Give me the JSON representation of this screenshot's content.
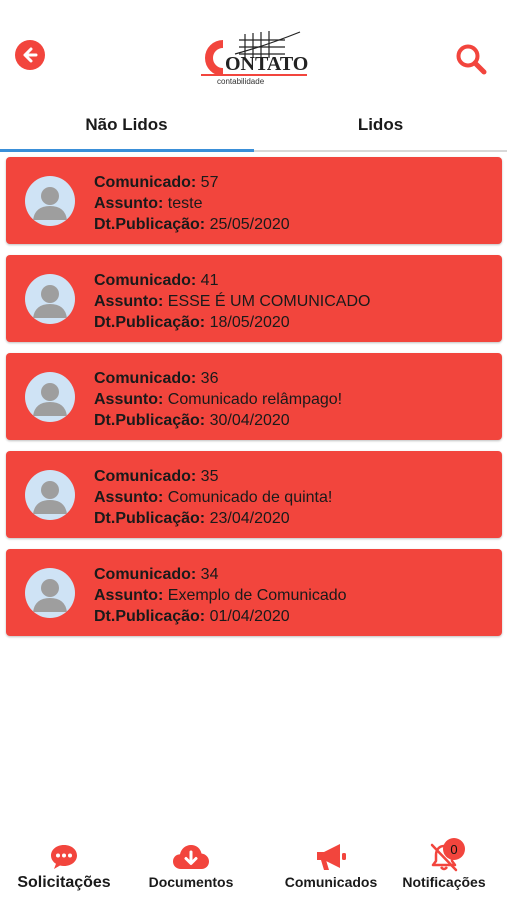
{
  "header": {
    "logo_text": "CONTATO",
    "logo_subtitle": "contabilidade"
  },
  "tabs": [
    {
      "label": "Não Lidos",
      "active": true
    },
    {
      "label": "Lidos",
      "active": false
    }
  ],
  "labels": {
    "comunicado": "Comunicado:",
    "assunto": "Assunto:",
    "publicacao": "Dt.Publicação:"
  },
  "items": [
    {
      "id": "57",
      "assunto": "teste",
      "data": "25/05/2020"
    },
    {
      "id": "41",
      "assunto": "ESSE É UM COMUNICADO",
      "data": "18/05/2020"
    },
    {
      "id": "36",
      "assunto": "Comunicado relâmpago!",
      "data": "30/04/2020"
    },
    {
      "id": "35",
      "assunto": "Comunicado de quinta!",
      "data": "23/04/2020"
    },
    {
      "id": "34",
      "assunto": "Exemplo de Comunicado",
      "data": "01/04/2020"
    }
  ],
  "bottom_nav": [
    {
      "label": "Solicitações",
      "icon": "chat-icon"
    },
    {
      "label": "Documentos",
      "icon": "cloud-download-icon"
    },
    {
      "label": "Comunicados",
      "icon": "megaphone-icon"
    },
    {
      "label": "Notificações",
      "icon": "bell-off-icon",
      "badge": "0"
    }
  ],
  "colors": {
    "accent": "#f2453d",
    "tab_indicator": "#3a8fd8"
  }
}
